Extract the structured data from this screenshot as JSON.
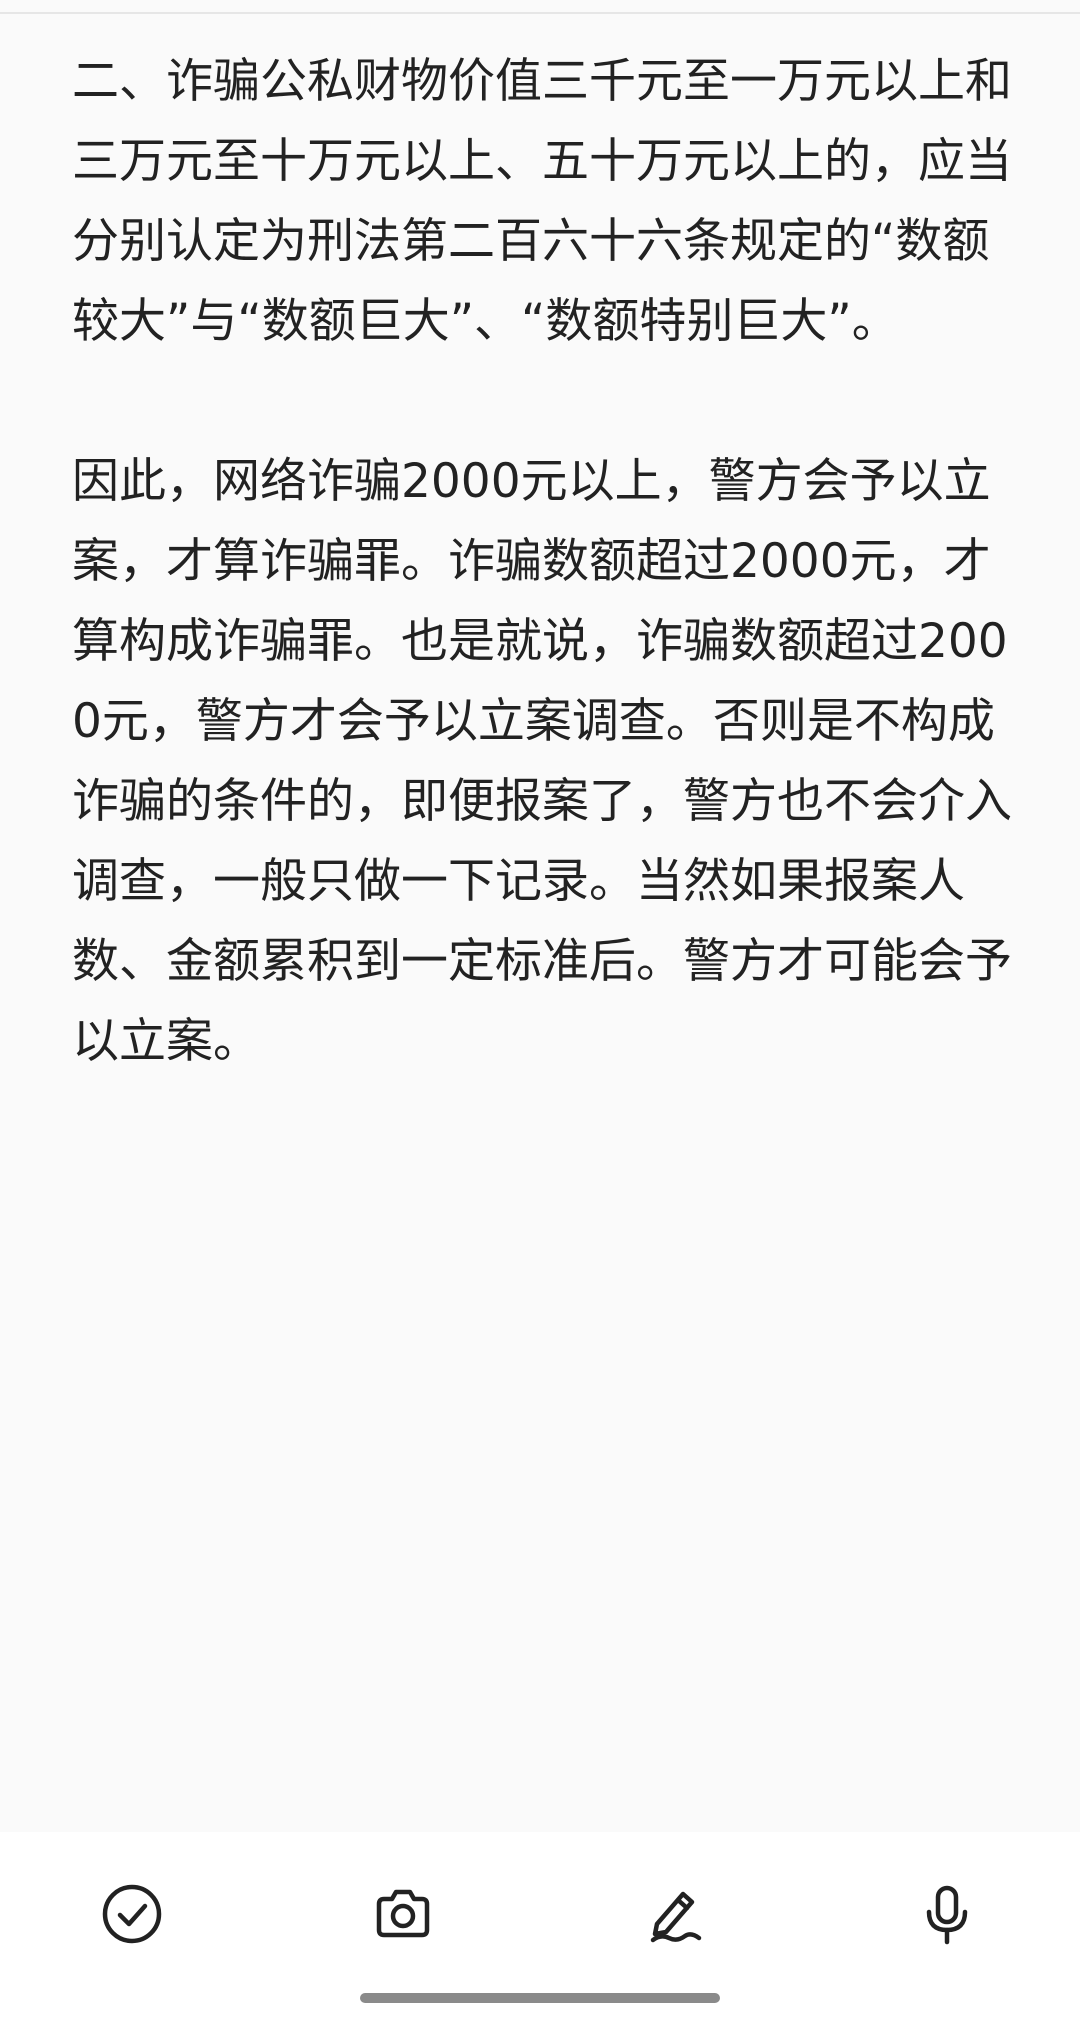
{
  "note": {
    "paragraphs": [
      "二、诈骗公私财物价值三千元至一万元以上和三万元至十万元以上、五十万元以上的，应当分别认定为刑法第二百六十六条规定的“数额较大”与“数额巨大”、“数额特别巨大”。",
      "因此，网络诈骗2000元以上，警方会予以立案，才算诈骗罪。诈骗数额超过2000元，才算构成诈骗罪。也是就说，诈骗数额超过2000元，警方才会予以立案调查。否则是不构成诈骗的条件的，即便报案了，警方也不会介入调查，一般只做一下记录。当然如果报案人数、金额累积到一定标准后。警方才可能会予以立案。"
    ]
  },
  "toolbar": {
    "icons": [
      "check-circle-icon",
      "camera-icon",
      "pen-icon",
      "microphone-icon"
    ],
    "icon_color": "#222222"
  },
  "colors": {
    "background": "#fafafa",
    "text": "#222222",
    "toolbar_background": "#ffffff",
    "home_indicator": "#8a8a8a"
  }
}
